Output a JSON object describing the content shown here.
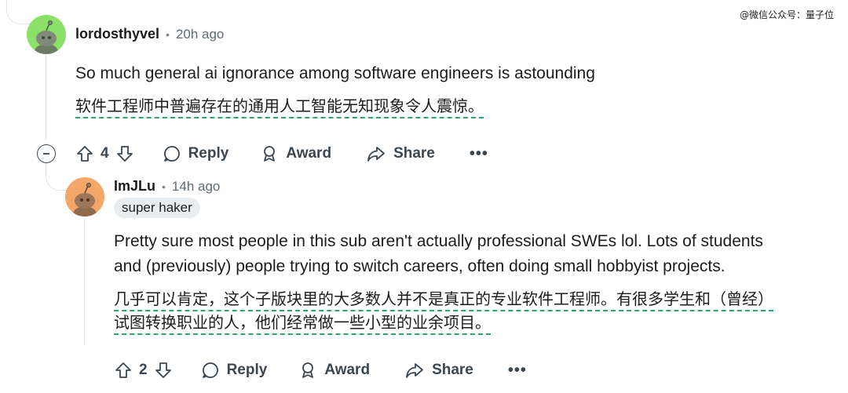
{
  "watermark": "@微信公众号：量子位",
  "comments": [
    {
      "username": "lordosthyvel",
      "separator": "•",
      "time": "20h ago",
      "avatar_color": "#8be06a",
      "text": "So much general ai ignorance among software engineers is astounding",
      "translation": "软件工程师中普遍存在的通用人工智能无知现象令人震惊。",
      "votes": "4",
      "reply_label": "Reply",
      "award_label": "Award",
      "share_label": "Share",
      "more_label": "•••"
    },
    {
      "username": "ImJLu",
      "separator": "•",
      "time": "14h ago",
      "flair": "super haker",
      "avatar_color": "#f3a769",
      "text_lines": [
        "Pretty sure most people in this sub aren't actually professional SWEs lol. Lots of students",
        "and (previously) people trying to switch careers, often doing small hobbyist projects."
      ],
      "translation_lines": [
        "几乎可以肯定，这个子版块里的大多数人并不是真正的专业软件工程师。有很多学生和（曾经）",
        "试图转换职业的人，他们经常做一些小型的业余项目。"
      ],
      "votes": "2",
      "reply_label": "Reply",
      "award_label": "Award",
      "share_label": "Share",
      "more_label": "•••"
    }
  ]
}
